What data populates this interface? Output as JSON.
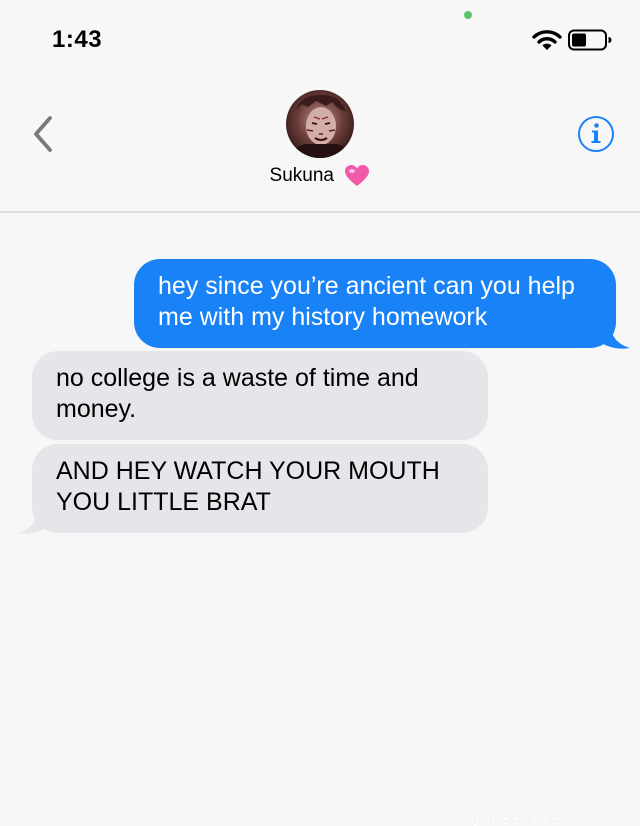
{
  "status_bar": {
    "time": "1:43",
    "battery_level": 0.45
  },
  "header": {
    "contact_name": "Sukuna",
    "back_icon": "chevron-left-icon",
    "info_icon": "info-icon",
    "heart_icon": "pink-heart-emoji"
  },
  "messages": [
    {
      "direction": "sent",
      "text": "hey since you’re ancient can you help me with my history homework"
    },
    {
      "direction": "received",
      "text": "no college is a waste of time and money."
    },
    {
      "direction": "received",
      "text": "AND HEY WATCH YOUR MOUTH YOU LITTLE BRAT"
    }
  ],
  "watermark": "ig @ • • • • • •",
  "colors": {
    "sent_bubble": "#1a82f7",
    "received_bubble": "#e6e5ea",
    "accent_blue": "#1a82f7",
    "heart_pink": "#f05aa8"
  }
}
